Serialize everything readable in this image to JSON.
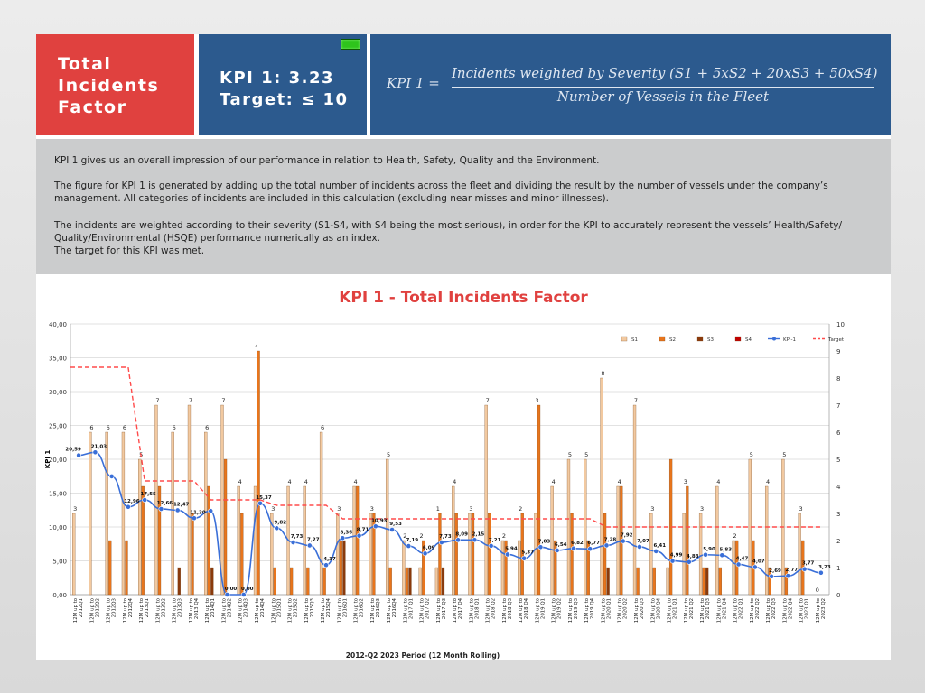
{
  "header": {
    "title_lines": [
      "Total",
      "Incidents",
      "Factor"
    ],
    "kpi_value": "KPI 1: 3.23",
    "target": "Target: ≤ 10",
    "formula_lhs": "KPI 1 =",
    "formula_numerator": "Incidents weighted by Severity (S1 + 5xS2 + 20xS3 + 50xS4)",
    "formula_denominator": "Number of Vessels in the Fleet"
  },
  "description": [
    "KPI 1 gives us an overall impression of our performance in relation to Health, Safety, Quality and the Environment.",
    "The figure for KPI 1 is generated by adding up the total number of incidents across the fleet and dividing the result by the number of vessels under the company’s management. All categories of incidents are included in this calculation (excluding near misses and minor illnesses).",
    "The incidents are weighted according to their severity (S1-S4, with S4 being the most serious), in order for the KPI to accurately represent the vessels’ Health/Safety/ Quality/Environmental (HSQE) performance numerically as an index.",
    "The target for this KPI was met."
  ],
  "colors": {
    "S1": "#f2c9a0",
    "S2": "#e8751c",
    "S3": "#8a3a0c",
    "S4": "#c00000",
    "KPI": "#3a6fd8",
    "Target": "#ff4b4b"
  },
  "chart_data": {
    "type": "bar",
    "title": "KPI 1 - Total Incidents Factor",
    "xlabel": "2012-Q2 2023 Period (12 Month Rolling)",
    "ylabel": "KPI 1",
    "ylim": [
      0,
      40
    ],
    "y2lim": [
      0,
      10
    ],
    "y_ticks": [
      "0,00",
      "5,00",
      "10,00",
      "15,00",
      "20,00",
      "25,00",
      "30,00",
      "35,00",
      "40,00"
    ],
    "y2_ticks": [
      "0",
      "1",
      "2",
      "3",
      "4",
      "5",
      "6",
      "7",
      "8",
      "9",
      "10"
    ],
    "legend_position": "top-right",
    "categories": [
      "12M up to 2012Q1",
      "12M up to 2012Q2",
      "12M up to 2012Q3",
      "12M up to 2012Q4",
      "12M up to 2013Q1",
      "12M up to 2013Q2",
      "12M up to 2013Q3",
      "12M up to 2013 Q4",
      "12M up to 2014Q1",
      "12M up to 2014Q2",
      "12M up to 2014Q3",
      "12M up to 2014Q4",
      "12M up to 2015Q1",
      "12M up to 2015Q2",
      "12M up to 2015Q3",
      "12M up to 2015Q4",
      "12M up to 2016Q1",
      "12M up to 2016Q2",
      "12M up to 2016Q3",
      "12M up to 2016Q4",
      "12M up to 2017 Q1",
      "12M up to 2017 Q2",
      "12M up to 2017 Q3",
      "12M up to 2017 Q4",
      "12M up to 2018 Q1",
      "12M up to 2018 Q2",
      "12M up to 2018 Q3",
      "12M up to 2018 Q4",
      "12M up to 2019 Q1",
      "12M up to 2019 Q2",
      "12M up to 2019 Q3",
      "12M up to 2019 Q4",
      "12M up to 2020 Q1",
      "12M up to 2020 Q2",
      "12M up to 2020 Q3",
      "12M up to 2020 Q4",
      "12M up to 2021 Q1",
      "12M up to 2021 Q2",
      "12M up to 2021 Q3",
      "12M up to 2021 Q4",
      "12M up to 2022 Q1",
      "12M up to 2022 Q2",
      "12M up to 2022 Q3",
      "12M up to 2022 Q4",
      "12M up to 2023 Q1",
      "12M up to 2023 Q2"
    ],
    "series": [
      {
        "name": "S1",
        "axis": "y",
        "values": [
          12,
          24,
          24,
          24,
          20,
          28,
          24,
          28,
          24,
          28,
          16,
          16,
          12,
          16,
          16,
          24,
          12,
          16,
          12,
          20,
          8,
          4,
          4,
          16,
          12,
          28,
          8,
          8,
          12,
          16,
          20,
          20,
          32,
          16,
          28,
          12,
          4,
          12,
          12,
          16,
          8,
          20,
          16,
          20,
          12,
          0
        ]
      },
      {
        "name": "S2",
        "axis": "y",
        "values": [
          0,
          0,
          8,
          8,
          16,
          16,
          0,
          12,
          16,
          20,
          12,
          36,
          4,
          4,
          4,
          4,
          8,
          16,
          12,
          4,
          4,
          8,
          12,
          12,
          12,
          12,
          8,
          12,
          28,
          8,
          12,
          8,
          12,
          16,
          4,
          4,
          20,
          16,
          4,
          4,
          8,
          8,
          4,
          4,
          8,
          0
        ]
      },
      {
        "name": "S3",
        "axis": "y",
        "values": [
          0,
          0,
          0,
          0,
          0,
          0,
          4,
          0,
          4,
          0,
          0,
          0,
          0,
          0,
          0,
          0,
          8,
          0,
          0,
          0,
          4,
          0,
          4,
          0,
          0,
          0,
          0,
          0,
          0,
          0,
          0,
          0,
          4,
          0,
          0,
          0,
          0,
          0,
          4,
          0,
          0,
          0,
          0,
          0,
          0,
          0
        ]
      },
      {
        "name": "S4",
        "axis": "y",
        "values": [
          0,
          0,
          0,
          0,
          0,
          0,
          0,
          0,
          0,
          0,
          0,
          0,
          0,
          0,
          0,
          0,
          0,
          0,
          0,
          0,
          0,
          0,
          0,
          0,
          0,
          0,
          0,
          0,
          0,
          0,
          0,
          0,
          0,
          0,
          0,
          0,
          0,
          0,
          0,
          0,
          0,
          0,
          0,
          0,
          0,
          0
        ]
      },
      {
        "name": "KPI-1",
        "axis": "y",
        "type": "line",
        "values": [
          20.59,
          21.03,
          17.48,
          12.96,
          14.0,
          12.66,
          12.47,
          11.3,
          12.37,
          0.0,
          0.0,
          13.5,
          9.82,
          7.73,
          7.27,
          4.37,
          8.36,
          8.71,
          10.1,
          9.6,
          7.19,
          6.09,
          7.73,
          8.09,
          8.1,
          7.21,
          5.94,
          5.37,
          7.03,
          6.54,
          6.82,
          6.77,
          7.28,
          7.92,
          7.07,
          6.41,
          4.99,
          4.83,
          5.9,
          5.83,
          4.47,
          4.07,
          2.69,
          2.77,
          3.77,
          3.23
        ]
      },
      {
        "name": "Target",
        "axis": "y2",
        "type": "line",
        "dashed": true,
        "values": [
          8.4,
          8.4,
          8.4,
          8.4,
          4.2,
          4.2,
          4.2,
          4.2,
          3.5,
          3.5,
          3.5,
          3.5,
          3.3,
          3.3,
          3.3,
          3.3,
          2.8,
          2.8,
          2.8,
          2.8,
          2.8,
          2.8,
          2.8,
          2.8,
          2.8,
          2.8,
          2.8,
          2.8,
          2.8,
          2.8,
          2.8,
          2.8,
          2.5,
          2.5,
          2.5,
          2.5,
          2.5,
          2.5,
          2.5,
          2.5,
          2.5,
          2.5,
          2.5,
          2.5,
          2.5,
          2.5
        ]
      }
    ],
    "kpi_labels": [
      "20,59",
      "21,03",
      "",
      "12,96",
      "17,55",
      "12,66",
      "12,47",
      "11,30",
      "",
      "0,00",
      "0,00",
      "15,37",
      "9,82",
      "7,73",
      "7,27",
      "4,37",
      "8,36",
      "8,71",
      "10,93",
      "9,53",
      "7,19",
      "6,09",
      "7,73",
      "8,09",
      "2,15",
      "7,21",
      "5,94",
      "5,37",
      "7,03",
      "6,54",
      "6,82",
      "6,77",
      "7,28",
      "7,92",
      "7,07",
      "6,41",
      "4,99",
      "4,83",
      "5,90",
      "5,83",
      "4,47",
      "4,07",
      "2,69",
      "2,77",
      "3,77",
      "3,23"
    ],
    "count_labels": [
      "3",
      "6",
      "6",
      "6",
      "5",
      "7",
      "6",
      "7",
      "6",
      "7",
      "4",
      "4",
      "3",
      "4",
      "4",
      "6",
      "3",
      "4",
      "3",
      "5",
      "2",
      "2",
      "1",
      "4",
      "3",
      "7",
      "2",
      "2",
      "3",
      "4",
      "5",
      "5",
      "8",
      "4",
      "7",
      "3",
      "",
      "3",
      "3",
      "4",
      "2",
      "5",
      "4",
      "5",
      "3",
      "0"
    ]
  }
}
